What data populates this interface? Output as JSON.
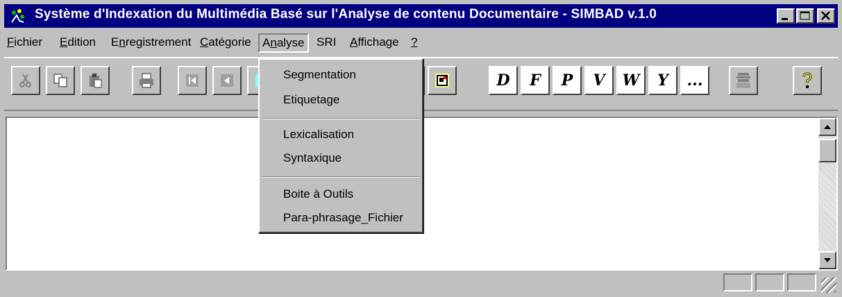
{
  "window": {
    "title": "Système d'Indexation du Multimédia Basé sur l'Analyse de contenu Documentaire - SIMBAD v.1.0",
    "buttons": {
      "minimize": "_",
      "maximize": "□",
      "close": "×"
    }
  },
  "menu": [
    {
      "label": "Fichier",
      "u": "F",
      "rest": "ichier"
    },
    {
      "label": "Edition",
      "u": "E",
      "rest": "dition"
    },
    {
      "label": "Enregistrement",
      "pre": "E",
      "u": "n",
      "rest": "registrement"
    },
    {
      "label": "Catégorie",
      "u": "C",
      "rest": "atégorie"
    },
    {
      "label": "Analyse",
      "pre": "A",
      "u": "n",
      "rest": "alyse"
    },
    {
      "label": "SRI"
    },
    {
      "label": "Affichage",
      "u": "A",
      "rest": "ffichage"
    },
    {
      "label": "?",
      "u": "?"
    }
  ],
  "analyse_menu": {
    "group1": [
      "Segmentation",
      "Etiquetage"
    ],
    "group2": [
      "Lexicalisation",
      "Syntaxique"
    ],
    "group3": [
      "Boite à Outils",
      "Para-phrasage_Fichier"
    ]
  },
  "toolbar": {
    "letters": [
      "D",
      "F",
      "P",
      "V",
      "W",
      "Y",
      "..."
    ],
    "icons": [
      "cut-icon",
      "copy-icon",
      "paste-icon",
      "print-icon",
      "first-record-icon",
      "previous-record-icon",
      "window-icon",
      "window-alt-icon",
      "dtc-icon",
      "help-icon"
    ]
  },
  "colors": {
    "titlebar": "#000080",
    "face": "#c0c0c0",
    "highlight_icon": "#ffff80"
  }
}
